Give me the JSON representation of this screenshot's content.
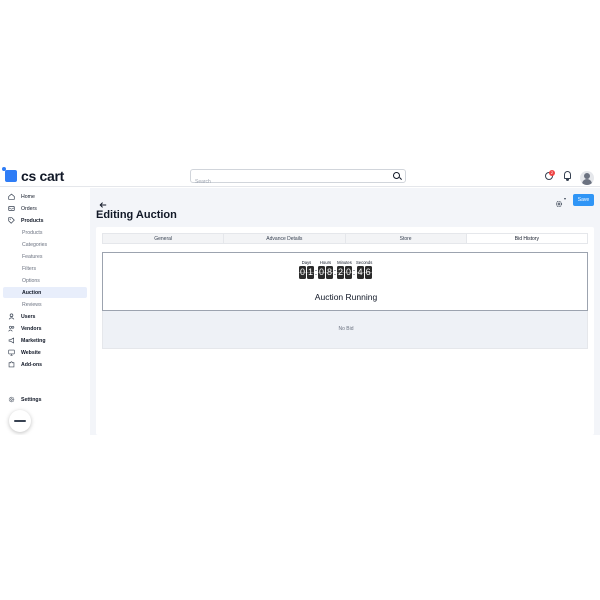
{
  "header": {
    "logo_text": "cs cart",
    "search_placeholder": "Search",
    "notification_count": "2"
  },
  "sidebar": {
    "items": [
      {
        "label": "Home",
        "icon": "home-icon"
      },
      {
        "label": "Orders",
        "icon": "orders-icon"
      },
      {
        "label": "Products",
        "icon": "tag-icon"
      },
      {
        "label": "Products"
      },
      {
        "label": "Categories"
      },
      {
        "label": "Features"
      },
      {
        "label": "Filters"
      },
      {
        "label": "Options"
      },
      {
        "label": "Auction"
      },
      {
        "label": "Reviews"
      },
      {
        "label": "Users",
        "icon": "users-icon"
      },
      {
        "label": "Vendors",
        "icon": "vendors-icon"
      },
      {
        "label": "Marketing",
        "icon": "megaphone-icon"
      },
      {
        "label": "Website",
        "icon": "monitor-icon"
      },
      {
        "label": "Add-ons",
        "icon": "puzzle-icon"
      }
    ],
    "settings_label": "Settings"
  },
  "main": {
    "title": "Editing Auction",
    "save_label": "Save",
    "tabs": [
      {
        "label": "General"
      },
      {
        "label": "Advance Details"
      },
      {
        "label": "Store"
      },
      {
        "label": "Bid History",
        "active": true
      }
    ],
    "countdown": {
      "units": [
        {
          "label": "Days",
          "digits": [
            "0",
            "1"
          ]
        },
        {
          "label": "Hours",
          "digits": [
            "0",
            "8"
          ]
        },
        {
          "label": "Minutes",
          "digits": [
            "2",
            "0"
          ]
        },
        {
          "label": "Seconds",
          "digits": [
            "4",
            "6"
          ]
        }
      ],
      "separator": ":"
    },
    "status": "Auction Running",
    "no_bid_text": "No Bid"
  },
  "colors": {
    "brand": "#2f7df6",
    "save_button": "#2f95f6",
    "active_nav": "#e8eefb",
    "badge": "#ef4444"
  }
}
